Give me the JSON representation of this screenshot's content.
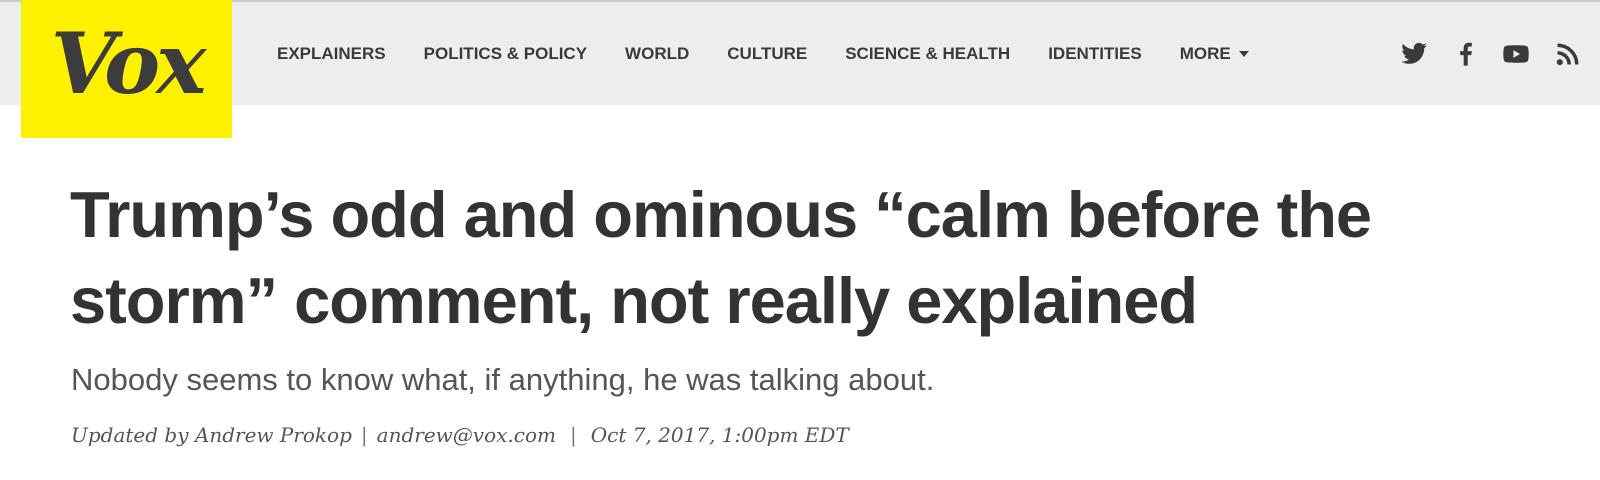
{
  "site": {
    "logo_text": "Vox",
    "brand_color": "#fff200",
    "nav_bg": "#eceeee"
  },
  "nav": {
    "items": [
      {
        "label": "EXPLAINERS"
      },
      {
        "label": "POLITICS & POLICY"
      },
      {
        "label": "WORLD"
      },
      {
        "label": "CULTURE"
      },
      {
        "label": "SCIENCE & HEALTH"
      },
      {
        "label": "IDENTITIES"
      },
      {
        "label": "MORE"
      }
    ],
    "more_icon": "caret-down-icon"
  },
  "social": {
    "icons": [
      "twitter-icon",
      "facebook-icon",
      "youtube-icon",
      "rss-icon"
    ]
  },
  "article": {
    "headline": "Trump’s odd and ominous “calm before the storm” comment, not really explained",
    "dek": "Nobody seems to know what, if anything, he was talking about.",
    "byline": {
      "author_text": "Updated by Andrew Prokop",
      "separator": "|",
      "email": "andrew@vox.com",
      "date": "Oct 7, 2017, 1:00pm EDT"
    }
  }
}
